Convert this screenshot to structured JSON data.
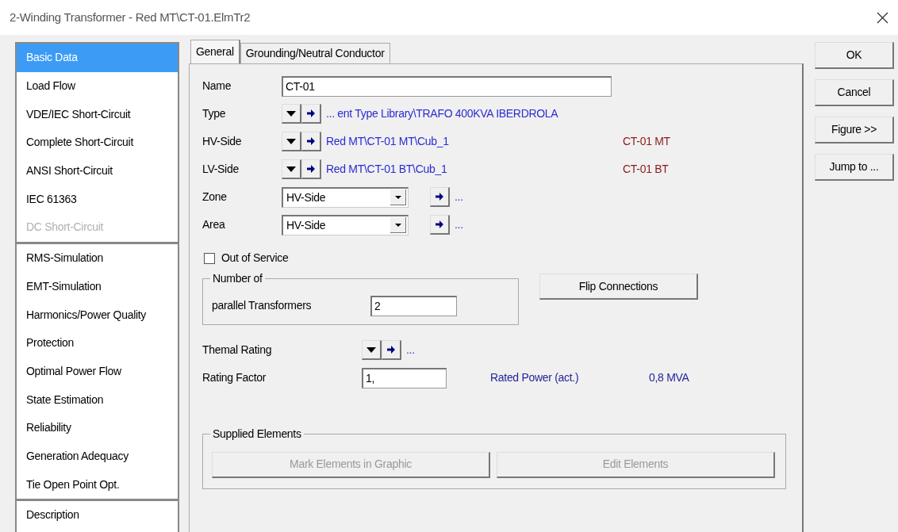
{
  "window": {
    "title": "2-Winding Transformer - Red MT\\CT-01.ElmTr2"
  },
  "sidebar": {
    "groups": [
      {
        "items": [
          {
            "label": "Basic Data",
            "selected": true,
            "disabled": false
          },
          {
            "label": "Load Flow",
            "selected": false,
            "disabled": false
          },
          {
            "label": "VDE/IEC Short-Circuit",
            "selected": false,
            "disabled": false
          },
          {
            "label": "Complete Short-Circuit",
            "selected": false,
            "disabled": false
          },
          {
            "label": "ANSI Short-Circuit",
            "selected": false,
            "disabled": false
          },
          {
            "label": "IEC 61363",
            "selected": false,
            "disabled": false
          },
          {
            "label": "DC Short-Circuit",
            "selected": false,
            "disabled": true
          }
        ]
      },
      {
        "items": [
          {
            "label": "RMS-Simulation",
            "selected": false,
            "disabled": false
          },
          {
            "label": "EMT-Simulation",
            "selected": false,
            "disabled": false
          },
          {
            "label": "Harmonics/Power Quality",
            "selected": false,
            "disabled": false
          },
          {
            "label": "Protection",
            "selected": false,
            "disabled": false
          },
          {
            "label": "Optimal Power Flow",
            "selected": false,
            "disabled": false
          },
          {
            "label": "State Estimation",
            "selected": false,
            "disabled": false
          },
          {
            "label": "Reliability",
            "selected": false,
            "disabled": false
          },
          {
            "label": "Generation Adequacy",
            "selected": false,
            "disabled": false
          },
          {
            "label": "Tie Open Point Opt.",
            "selected": false,
            "disabled": false
          }
        ]
      },
      {
        "items": [
          {
            "label": "Description",
            "selected": false,
            "disabled": false
          }
        ]
      }
    ]
  },
  "tabs": [
    {
      "label": "General",
      "selected": true
    },
    {
      "label": "Grounding/Neutral Conductor",
      "selected": false
    }
  ],
  "form": {
    "name": {
      "label": "Name",
      "value": "CT-01"
    },
    "references": [
      {
        "label": "Type",
        "path": "... ent Type Library\\TRAFO 400KVA IBERDROLA"
      },
      {
        "label": "HV-Side",
        "path": "Red MT\\CT-01 MT\\Cub_1",
        "terminal": "CT-01 MT"
      },
      {
        "label": "LV-Side",
        "path": "Red MT\\CT-01 BT\\Cub_1",
        "terminal": "CT-01 BT"
      }
    ],
    "selects": [
      {
        "label": "Zone",
        "value": "HV-Side",
        "more": "..."
      },
      {
        "label": "Area",
        "value": "HV-Side",
        "more": "..."
      }
    ],
    "out_of_service": {
      "label": "Out of Service",
      "checked": false
    },
    "number_group": {
      "title": "Number of",
      "label": "parallel Transformers",
      "value": "2"
    },
    "flip_button": "Flip Connections",
    "thermal_rating": {
      "label": "Themal Rating",
      "more": "..."
    },
    "rating_factor": {
      "label": "Rating Factor",
      "value": "1,"
    },
    "rated_power": {
      "label": "Rated Power (act.)",
      "value": "0,8 MVA"
    },
    "supplied": {
      "title": "Supplied Elements",
      "buttons": [
        {
          "label": "Mark Elements in Graphic",
          "disabled": true
        },
        {
          "label": "Edit Elements",
          "disabled": true
        }
      ]
    }
  },
  "buttons": [
    {
      "label": "OK"
    },
    {
      "label": "Cancel"
    },
    {
      "label": "Figure >>"
    },
    {
      "label": "Jump to ..."
    }
  ]
}
